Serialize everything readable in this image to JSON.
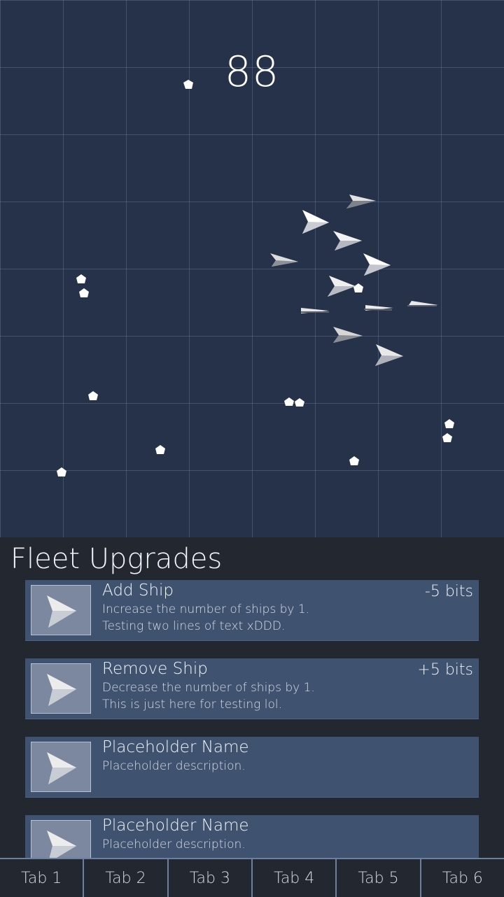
{
  "game": {
    "score": "88",
    "colors": {
      "background": "#26314a",
      "grid": "#4a5a78",
      "ship": "#ffffff",
      "debris": "#ffffff"
    }
  },
  "panel": {
    "title": "Fleet Upgrades",
    "upgrades": [
      {
        "name": "Add Ship",
        "desc1": "Increase the number of ships by 1.",
        "desc2": "Testing two lines of text xDDD.",
        "cost": "-5 bits",
        "icon": "play-icon"
      },
      {
        "name": "Remove Ship",
        "desc1": "Decrease the number of ships by 1.",
        "desc2": "This is just here for testing lol.",
        "cost": "+5 bits",
        "icon": "play-icon"
      },
      {
        "name": "Placeholder Name",
        "desc1": "Placeholder description.",
        "desc2": "",
        "cost": "",
        "icon": "play-icon"
      },
      {
        "name": "Placeholder Name",
        "desc1": "Placeholder description.",
        "desc2": "",
        "cost": "",
        "icon": "play-icon"
      }
    ]
  },
  "tabs": [
    "Tab 1",
    "Tab 2",
    "Tab 3",
    "Tab 4",
    "Tab 5",
    "Tab 6"
  ]
}
